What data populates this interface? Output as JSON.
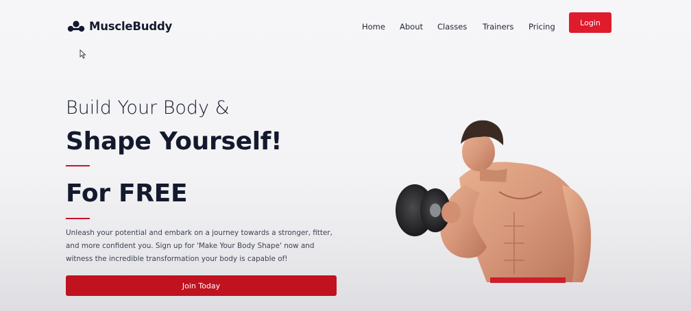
{
  "brand": {
    "name": "MuscleBuddy",
    "logo_icon": "dumbbell-icon"
  },
  "nav": {
    "items": [
      {
        "label": "Home"
      },
      {
        "label": "About"
      },
      {
        "label": "Classes"
      },
      {
        "label": "Trainers"
      },
      {
        "label": "Pricing"
      }
    ],
    "login_label": "Login"
  },
  "hero": {
    "title_line1": "Build Your Body &",
    "title_line2": "Shape Yourself!",
    "title_line3": "For FREE",
    "description": "Unleash your potential and embark on a journey towards a stronger, fitter, and more confident you. Sign up for 'Make Your Body Shape' now and witness the incredible transformation your body is capable of!",
    "cta_label": "Join Today",
    "image": "muscular-man-lifting-dumbbell"
  },
  "colors": {
    "accent": "#df1b2c",
    "cta": "#c0121f",
    "heading": "#141a2e",
    "background": "#f5f5f7"
  }
}
